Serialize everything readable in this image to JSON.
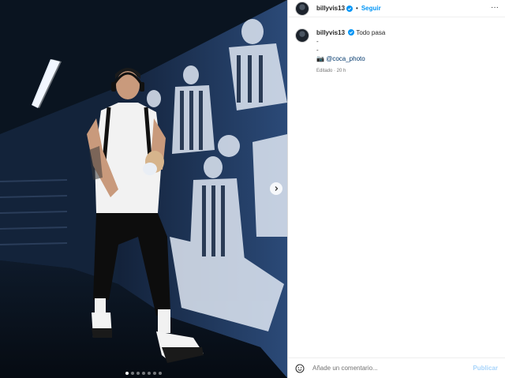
{
  "post": {
    "username": "billyvis13",
    "follow_label": "Seguir",
    "separator": "•",
    "more_label": "···",
    "media": {
      "image_count": 7,
      "active_index": 0
    },
    "caption": {
      "username": "billyvis13",
      "text": "Todo pasa",
      "lines": [
        "-",
        "-"
      ],
      "credit_prefix": "📷",
      "credit_mention": "@coca_photo",
      "meta": "Editado · 20 h"
    },
    "comment": {
      "placeholder": "Añade un comentario...",
      "publish_label": "Publicar"
    }
  }
}
